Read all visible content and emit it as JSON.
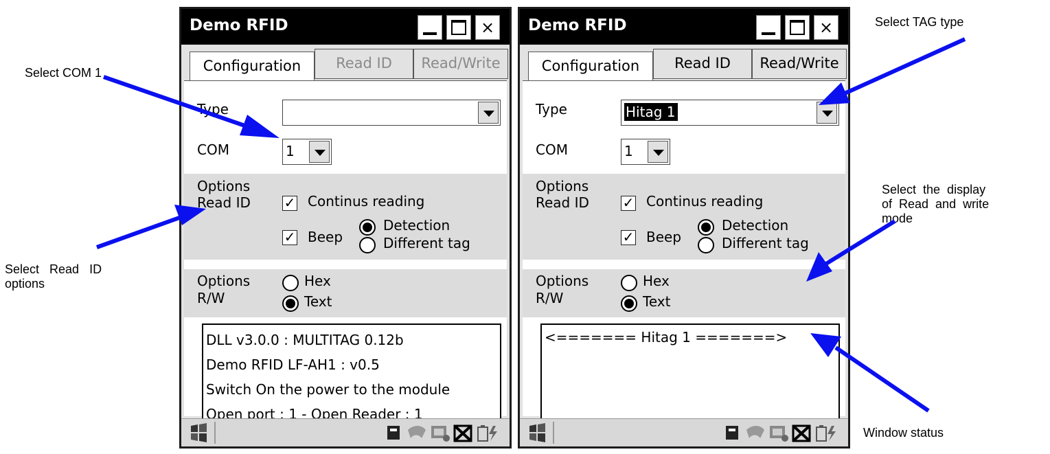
{
  "annotations": {
    "select_com": "Select COM 1",
    "read_id_options_line1": "Select   Read   ID",
    "read_id_options_line2": "options",
    "select_tag_type": "Select TAG type",
    "display_mode_line1": "Select  the  display",
    "display_mode_line2": "of  Read  and  write",
    "display_mode_line3": "mode",
    "window_status": "Window status"
  },
  "colors": {
    "arrow": "#0a10ee",
    "titlebar": "#000000",
    "group_bg": "#dcdcdc"
  },
  "windows": [
    {
      "title": "Demo RFID",
      "tabs": {
        "configuration": "Configuration",
        "read_id": "Read ID",
        "read_write": "Read/Write",
        "disabled": true
      },
      "type_label": "Type",
      "type_value": "",
      "com_label": "COM",
      "com_value": "1",
      "options_read_id": {
        "label1": "Options",
        "label2": "Read ID",
        "continuous": "Continus reading",
        "continuous_checked": true,
        "beep": "Beep",
        "beep_checked": true,
        "detection": "Detection",
        "different_tag": "Different tag",
        "selected": "Detection"
      },
      "options_rw": {
        "label1": "Options",
        "label2": "R/W",
        "hex": "Hex",
        "text": "Text",
        "selected": "Text"
      },
      "status_lines": [
        "DLL v3.0.0 : MULTITAG 0.12b",
        "Demo RFID LF-AH1 : v0.5",
        "Switch On the power to the module",
        "Open port : 1 - Open Reader : 1"
      ]
    },
    {
      "title": "Demo RFID",
      "tabs": {
        "configuration": "Configuration",
        "read_id": "Read ID",
        "read_write": "Read/Write",
        "disabled": false
      },
      "type_label": "Type",
      "type_value": "Hitag 1",
      "com_label": "COM",
      "com_value": "1",
      "options_read_id": {
        "label1": "Options",
        "label2": "Read ID",
        "continuous": "Continus reading",
        "continuous_checked": true,
        "beep": "Beep",
        "beep_checked": true,
        "detection": "Detection",
        "different_tag": "Different tag",
        "selected": "Detection"
      },
      "options_rw": {
        "label1": "Options",
        "label2": "R/W",
        "hex": "Hex",
        "text": "Text",
        "selected": "Text"
      },
      "status_lines": [
        "<======= Hitag 1 =======>"
      ]
    }
  ],
  "icons": {
    "titlebar": [
      "minimize-icon",
      "maximize-icon",
      "close-icon"
    ],
    "taskbar": [
      "start-icon",
      "keyboard-icon",
      "network-icon",
      "device-icon",
      "no-connection-icon",
      "battery-icon"
    ]
  }
}
